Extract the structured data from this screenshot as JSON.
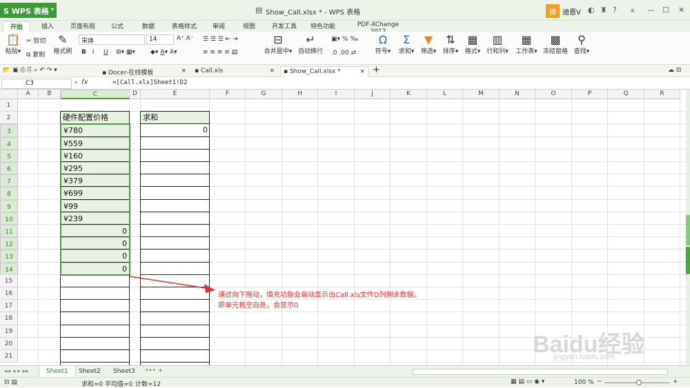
{
  "app": {
    "name": "WPS 表格",
    "doc_title": "Show_Call.xlsx * - WPS 表格",
    "user_badge": "迪",
    "user_name": "迪恩V"
  },
  "ribbon_tabs": [
    "开始",
    "插入",
    "页面布局",
    "公式",
    "数据",
    "表格样式",
    "审阅",
    "视图",
    "开发工具",
    "特色功能",
    "PDF-XChange 2012"
  ],
  "ribbon": {
    "paste": "粘贴",
    "cut": "剪切",
    "copy": "复制",
    "format_painter": "格式刷",
    "font_name": "宋体",
    "font_size": "14",
    "bold": "B",
    "italic": "I",
    "underline": "U",
    "merge_center": "合并居中",
    "wrap": "自动换行",
    "percent": "%",
    "symbol": "符号",
    "sum": "求和",
    "filter": "筛选",
    "sort": "排序",
    "format": "格式",
    "rowcol": "行和列",
    "worksheet": "工作表",
    "freeze": "冻结窗格",
    "find": "查找"
  },
  "doc_tabs": [
    "Docer-在线模板",
    "Call.xls",
    "Show_Call.xlsx *"
  ],
  "formula_bar": {
    "cell": "C3",
    "fx": "fx",
    "formula": "=[Call.xls]Sheet1!D2"
  },
  "columns": [
    "A",
    "B",
    "C",
    "D",
    "E",
    "F",
    "G",
    "H",
    "I",
    "J",
    "K",
    "L",
    "M",
    "N",
    "O",
    "P",
    "Q",
    "R"
  ],
  "rows": [
    "1",
    "2",
    "3",
    "4",
    "5",
    "6",
    "7",
    "8",
    "9",
    "10",
    "11",
    "12",
    "13",
    "14",
    "15",
    "16",
    "17",
    "18",
    "19",
    "20",
    "21"
  ],
  "cells": {
    "c_header": "硬件配置价格",
    "e_header": "求和",
    "e_sum": "0",
    "c_values": [
      "¥780",
      "¥559",
      "¥160",
      "¥295",
      "¥379",
      "¥699",
      "¥99",
      "¥239",
      "0",
      "0",
      "0",
      "0"
    ]
  },
  "annotation": {
    "line1": "通过向下拖动，填充功能会自动显示出Call.xls文件D列剩余数据，",
    "line2": "原单元格空白处，会显示0"
  },
  "sheet_tabs": [
    "Sheet1",
    "Sheet2",
    "Sheet3"
  ],
  "status": {
    "sum": "求和=0",
    "avg": "平均值=0",
    "count": "计数=12",
    "zoom": "100 %"
  },
  "watermark": {
    "main": "Baidu经验",
    "sub": "jingyan.baidu.com"
  },
  "colors": {
    "accent": "#3c9a37",
    "annotation": "#e03030"
  }
}
